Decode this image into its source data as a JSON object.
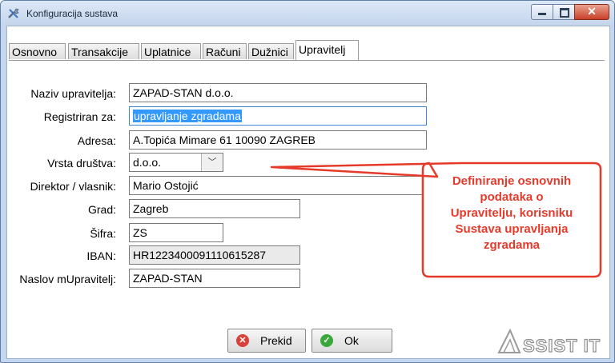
{
  "window": {
    "title": "Konfiguracija sustava",
    "close_glyph": "✕"
  },
  "tabs": [
    {
      "label": "Osnovno"
    },
    {
      "label": "Transakcije"
    },
    {
      "label": "Uplatnice"
    },
    {
      "label": "Računi"
    },
    {
      "label": "Dužnici"
    },
    {
      "label": "Upravitelj"
    }
  ],
  "form": {
    "naziv": {
      "label": "Naziv upravitelja:",
      "value": "ZAPAD-STAN d.o.o."
    },
    "registriran": {
      "label": "Registriran za:",
      "value": "upravljanje zgradama"
    },
    "adresa": {
      "label": "Adresa:",
      "value": "A.Topića Mimare 61 10090 ZAGREB"
    },
    "vrsta": {
      "label": "Vrsta društva:",
      "value": "d.o.o.",
      "arrow": "﹀"
    },
    "direktor": {
      "label": "Direktor / vlasnik:",
      "value": "Mario Ostojić"
    },
    "grad": {
      "label": "Grad:",
      "value": "Zagreb"
    },
    "sifra": {
      "label": "Šifra:",
      "value": "ZS"
    },
    "iban": {
      "label": "IBAN:",
      "value": "HR1223400091110615287"
    },
    "naslov": {
      "label": "Naslov mUpravitelj:",
      "value": "ZAPAD-STAN"
    }
  },
  "buttons": {
    "cancel": {
      "label": "Prekid",
      "icon": "✕",
      "color": "#d8423a"
    },
    "ok": {
      "label": "Ok",
      "icon": "✓",
      "color": "#3aa83a"
    }
  },
  "callout": {
    "lines": [
      "Definiranje osnovnih",
      "podataka o",
      "Upravitelju, korisniku",
      "Sustava upravljanja",
      "zgradama"
    ],
    "color": "#e53a2a"
  },
  "logo": {
    "text": "ASSIST IT"
  },
  "colors": {
    "accent": "#3399ff",
    "titlebar": "#c3d5ec"
  }
}
